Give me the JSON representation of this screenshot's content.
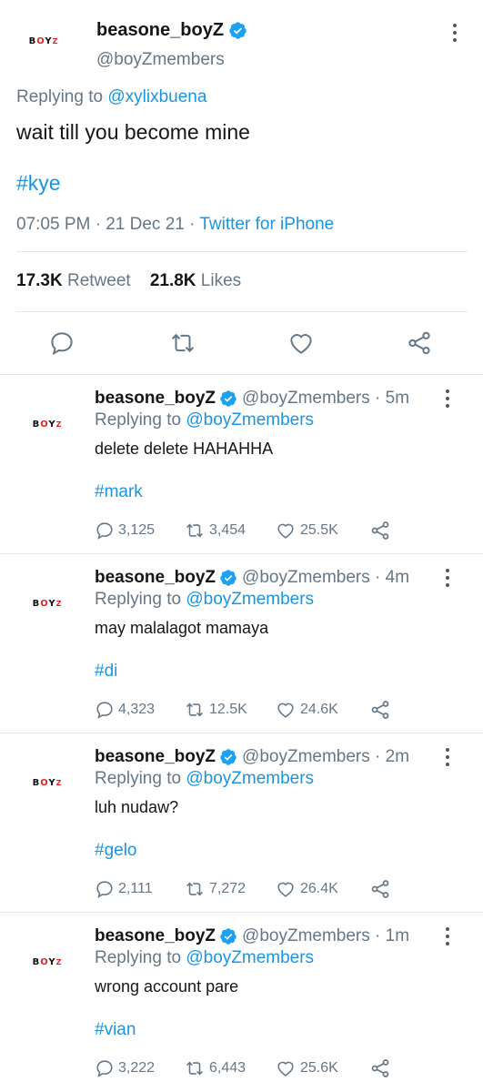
{
  "main_tweet": {
    "avatar_logo": "BOYZ",
    "display_name": "beasone_boyZ",
    "handle": "@boyZmembers",
    "replying_prefix": "Replying to",
    "replying_to": "@xylixbuena",
    "text": "wait till you become mine",
    "hashtag": "#kye",
    "timestamp": "07:05 PM · 21 Dec 21 ·",
    "source": "Twitter for iPhone",
    "retweets_count": "17.3K",
    "retweets_label": "Retweet",
    "likes_count": "21.8K",
    "likes_label": "Likes"
  },
  "replies": [
    {
      "display_name": "beasone_boyZ",
      "handle_time": "@boyZmembers · 5m",
      "replying_prefix": "Replying to",
      "replying_to": "@boyZmembers",
      "text": "delete delete HAHAHHA",
      "hashtag": "#mark",
      "replies": "3,125",
      "retweets": "3,454",
      "likes": "25.5K"
    },
    {
      "display_name": "beasone_boyZ",
      "handle_time": "@boyZmembers · 4m",
      "replying_prefix": "Replying to",
      "replying_to": "@boyZmembers",
      "text": "may malalagot mamaya",
      "hashtag": "#di",
      "replies": "4,323",
      "retweets": "12.5K",
      "likes": "24.6K"
    },
    {
      "display_name": "beasone_boyZ",
      "handle_time": "@boyZmembers · 2m",
      "replying_prefix": "Replying to",
      "replying_to": "@boyZmembers",
      "text": "luh nudaw?",
      "hashtag": "#gelo",
      "replies": "2,111",
      "retweets": "7,272",
      "likes": "26.4K"
    },
    {
      "display_name": "beasone_boyZ",
      "handle_time": "@boyZmembers · 1m",
      "replying_prefix": "Replying to",
      "replying_to": "@boyZmembers",
      "text": "wrong account pare",
      "hashtag": "#vian",
      "replies": "3,222",
      "retweets": "6,443",
      "likes": "25.6K"
    }
  ],
  "colors": {
    "link_blue": "#1b95e0",
    "secondary_grey": "#657786",
    "verified_blue": "#1da1f2",
    "logo_red": "#e0242b"
  },
  "icons": [
    "verified-badge-icon",
    "more-options-icon",
    "reply-icon",
    "retweet-icon",
    "like-icon",
    "share-icon"
  ]
}
